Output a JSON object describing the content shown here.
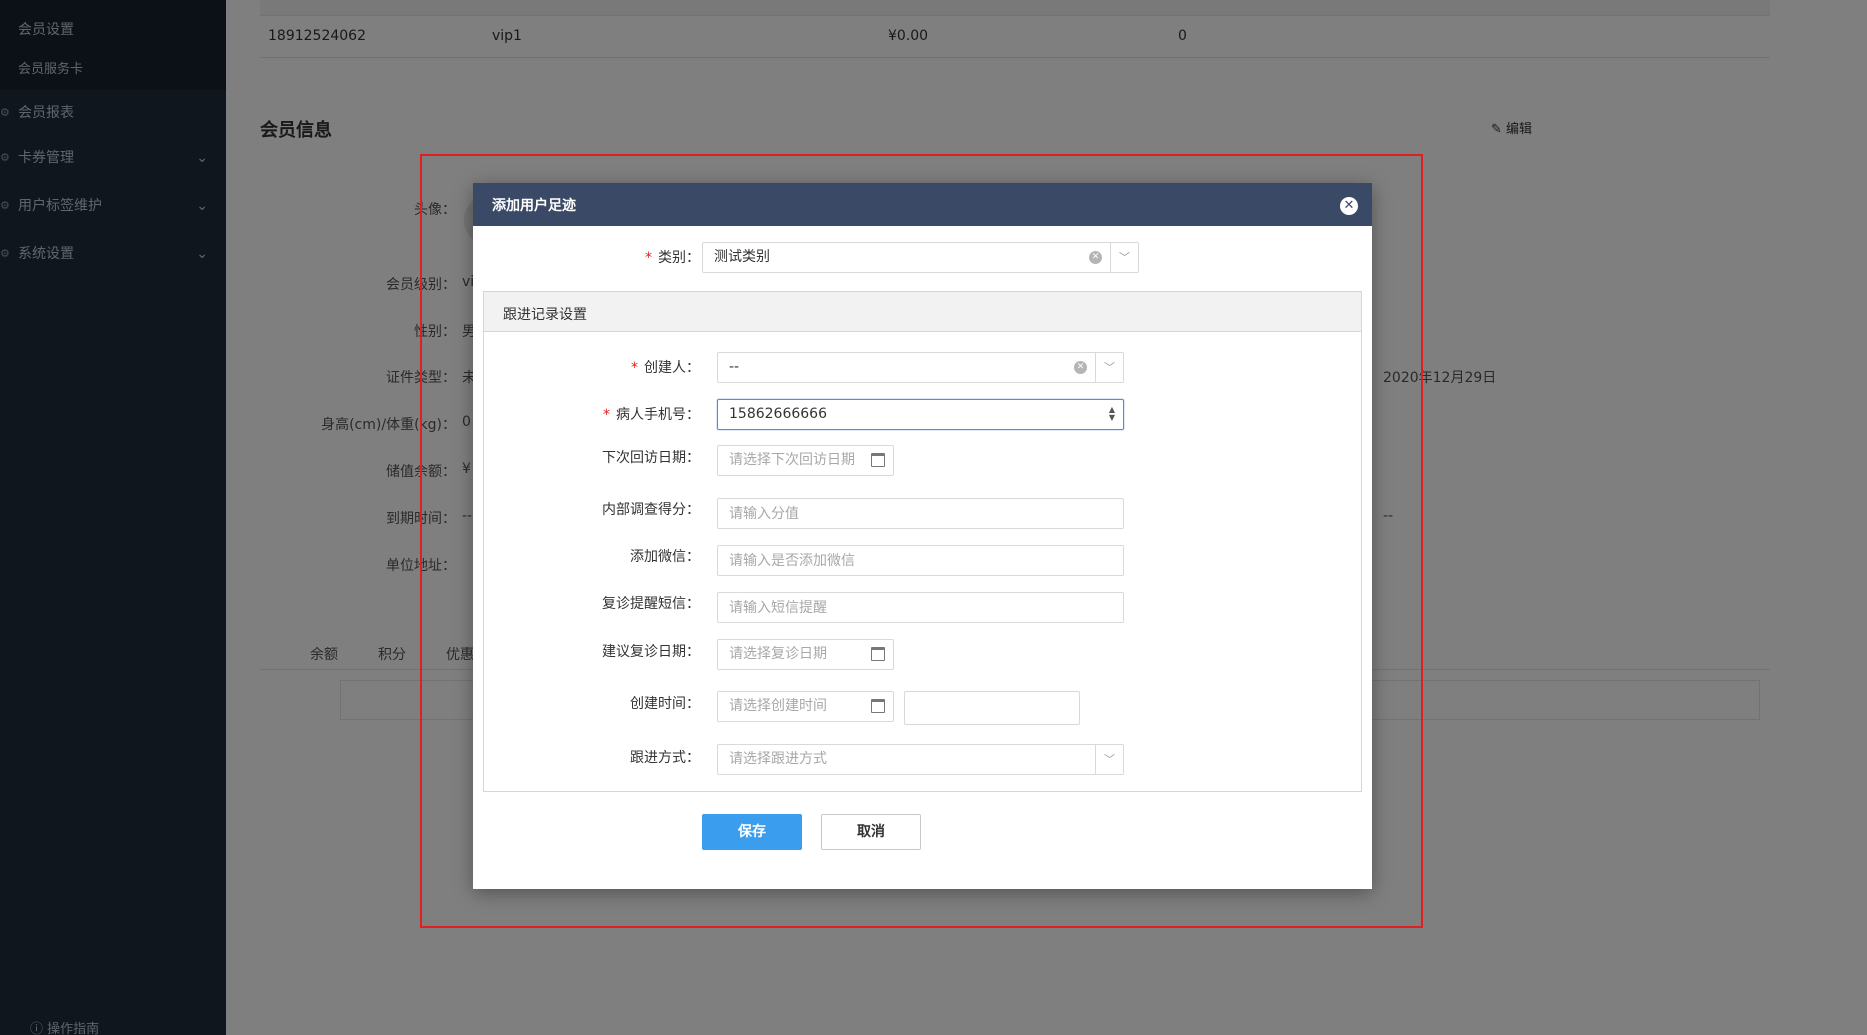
{
  "sidebar": {
    "items": [
      {
        "label": "会员设置"
      },
      {
        "label": "会员服务卡"
      },
      {
        "label": "会员报表"
      },
      {
        "label": "卡券管理"
      },
      {
        "label": "用户标签维护"
      },
      {
        "label": "系统设置"
      }
    ],
    "footer": "操作指南"
  },
  "table": {
    "row": {
      "phone": "18912524062",
      "level": "vip1",
      "amount": "¥0.00",
      "count": "0"
    }
  },
  "member": {
    "section_title": "会员信息",
    "edit_label": "编辑",
    "labels": {
      "avatar": "头像：",
      "level": "会员级别：",
      "gender": "性别：",
      "id_type": "证件类型：",
      "height_weight": "身高(cm)/体重(kg)：",
      "balance": "储值余额：",
      "expire": "到期时间：",
      "address": "单位地址："
    },
    "values": {
      "level": "vi",
      "gender": "男",
      "id_type": "未",
      "height_weight": "0",
      "balance": "¥",
      "expire": "--",
      "date_right": "2020年12月29日",
      "dash_right": "--"
    },
    "tabs": [
      "余额",
      "积分",
      "优惠"
    ]
  },
  "modal": {
    "title": "添加用户足迹",
    "category": {
      "label": "类别：",
      "value": "测试类别"
    },
    "section_title": "跟进记录设置",
    "creator": {
      "label": "创建人：",
      "value": "--"
    },
    "phone": {
      "label": "病人手机号：",
      "value": "15862666666"
    },
    "next_visit": {
      "label": "下次回访日期：",
      "placeholder": "请选择下次回访日期"
    },
    "survey_score": {
      "label": "内部调查得分：",
      "placeholder": "请输入分值"
    },
    "wechat": {
      "label": "添加微信：",
      "placeholder": "请输入是否添加微信"
    },
    "sms": {
      "label": "复诊提醒短信：",
      "placeholder": "请输入短信提醒"
    },
    "suggest_date": {
      "label": "建议复诊日期：",
      "placeholder": "请选择复诊日期"
    },
    "create_time": {
      "label": "创建时间：",
      "placeholder": "请选择创建时间",
      "time_value": ""
    },
    "follow_method": {
      "label": "跟进方式：",
      "placeholder": "请选择跟进方式"
    },
    "save_label": "保存",
    "cancel_label": "取消"
  }
}
